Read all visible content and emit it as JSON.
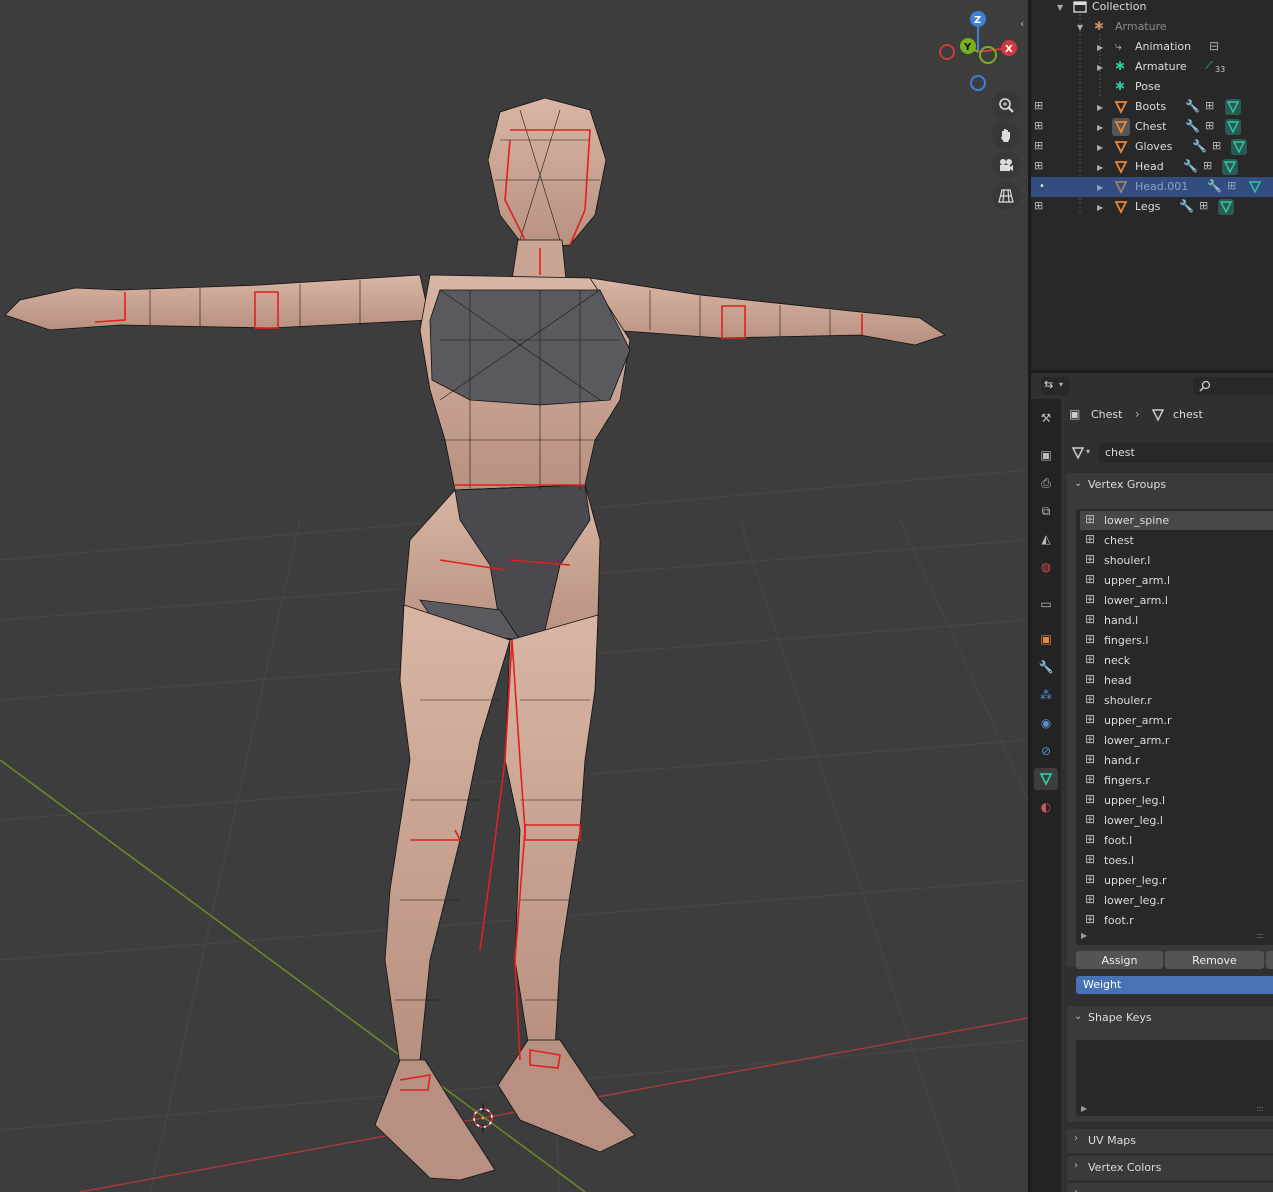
{
  "viewport": {
    "gizmo": {
      "z": "Z",
      "y": "Y",
      "x": "X"
    }
  },
  "outliner": {
    "rows": [
      {
        "label": "Collection"
      },
      {
        "label": "Armature"
      },
      {
        "label": "Animation"
      },
      {
        "label": "Armature",
        "badge": "33"
      },
      {
        "label": "Pose"
      },
      {
        "label": "Boots"
      },
      {
        "label": "Chest"
      },
      {
        "label": "Gloves"
      },
      {
        "label": "Head"
      },
      {
        "label": "Head.001"
      },
      {
        "label": "Legs"
      }
    ]
  },
  "properties": {
    "breadcrumb": {
      "object": "Chest",
      "data": "chest"
    },
    "mesh_name": "chest",
    "vertex_groups": {
      "title": "Vertex Groups",
      "active": "lower_spine",
      "items": [
        "lower_spine",
        "chest",
        "shouler.l",
        "upper_arm.l",
        "lower_arm.l",
        "hand.l",
        "fingers.l",
        "neck",
        "head",
        "shouler.r",
        "upper_arm.r",
        "lower_arm.r",
        "hand.r",
        "fingers.r",
        "upper_leg.l",
        "lower_leg.l",
        "foot.l",
        "toes.l",
        "upper_leg.r",
        "lower_leg.r",
        "foot.r"
      ],
      "assign": "Assign",
      "remove": "Remove",
      "weight": "Weight"
    },
    "panels": {
      "shape_keys": "Shape Keys",
      "uv_maps": "UV Maps",
      "vertex_colors": "Vertex Colors"
    }
  },
  "colors": {
    "selection": "#334d80",
    "weight_bar": "#4772b3",
    "mesh_green": "#2fc4a0",
    "mesh_orange": "#e8883a"
  }
}
